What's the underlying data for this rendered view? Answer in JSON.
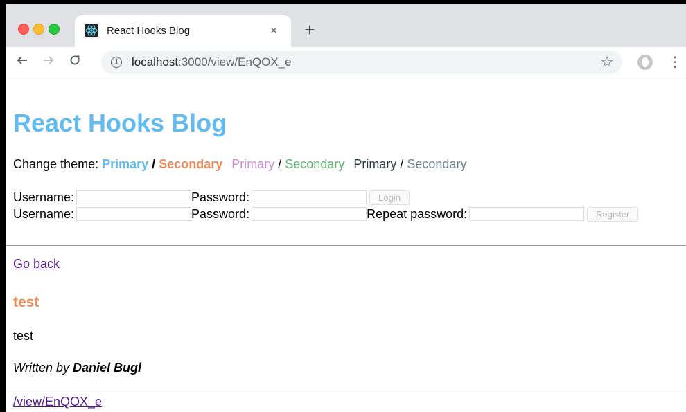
{
  "browser": {
    "tab_title": "React Hooks Blog",
    "tab_close": "×",
    "new_tab": "+",
    "url_host": "localhost",
    "url_rest": ":3000/view/EnQOX_e",
    "icons": [
      "back-arrow-icon",
      "forward-arrow-icon",
      "reload-icon",
      "info-icon",
      "star-icon",
      "profile-icon",
      "menu-icon",
      "react-logo-icon"
    ]
  },
  "app": {
    "title": "React Hooks Blog"
  },
  "theme": {
    "label": "Change theme:",
    "options": [
      {
        "primary": "Primary",
        "sep": "/",
        "secondary": "Secondary",
        "primary_color": "#61bbf0",
        "secondary_color": "#ef8c5a"
      },
      {
        "primary": "Primary",
        "sep": "/",
        "secondary": "Secondary",
        "primary_color": "#d28ad9",
        "secondary_color": "#58b36b"
      },
      {
        "primary": "Primary",
        "sep": "/",
        "secondary": "Secondary",
        "primary_color": "#2d3b45",
        "secondary_color": "#708290"
      }
    ]
  },
  "login": {
    "username_label": "Username:",
    "password_label": "Password:",
    "button": "Login"
  },
  "register": {
    "username_label": "Username:",
    "password_label": "Password:",
    "repeat_label": "Repeat password:",
    "button": "Register"
  },
  "post": {
    "back_link": "Go back",
    "title": "test",
    "content": "test",
    "byline_prefix": "Written by",
    "author": "Daniel Bugl",
    "path_link": "/view/EnQOX_e"
  }
}
